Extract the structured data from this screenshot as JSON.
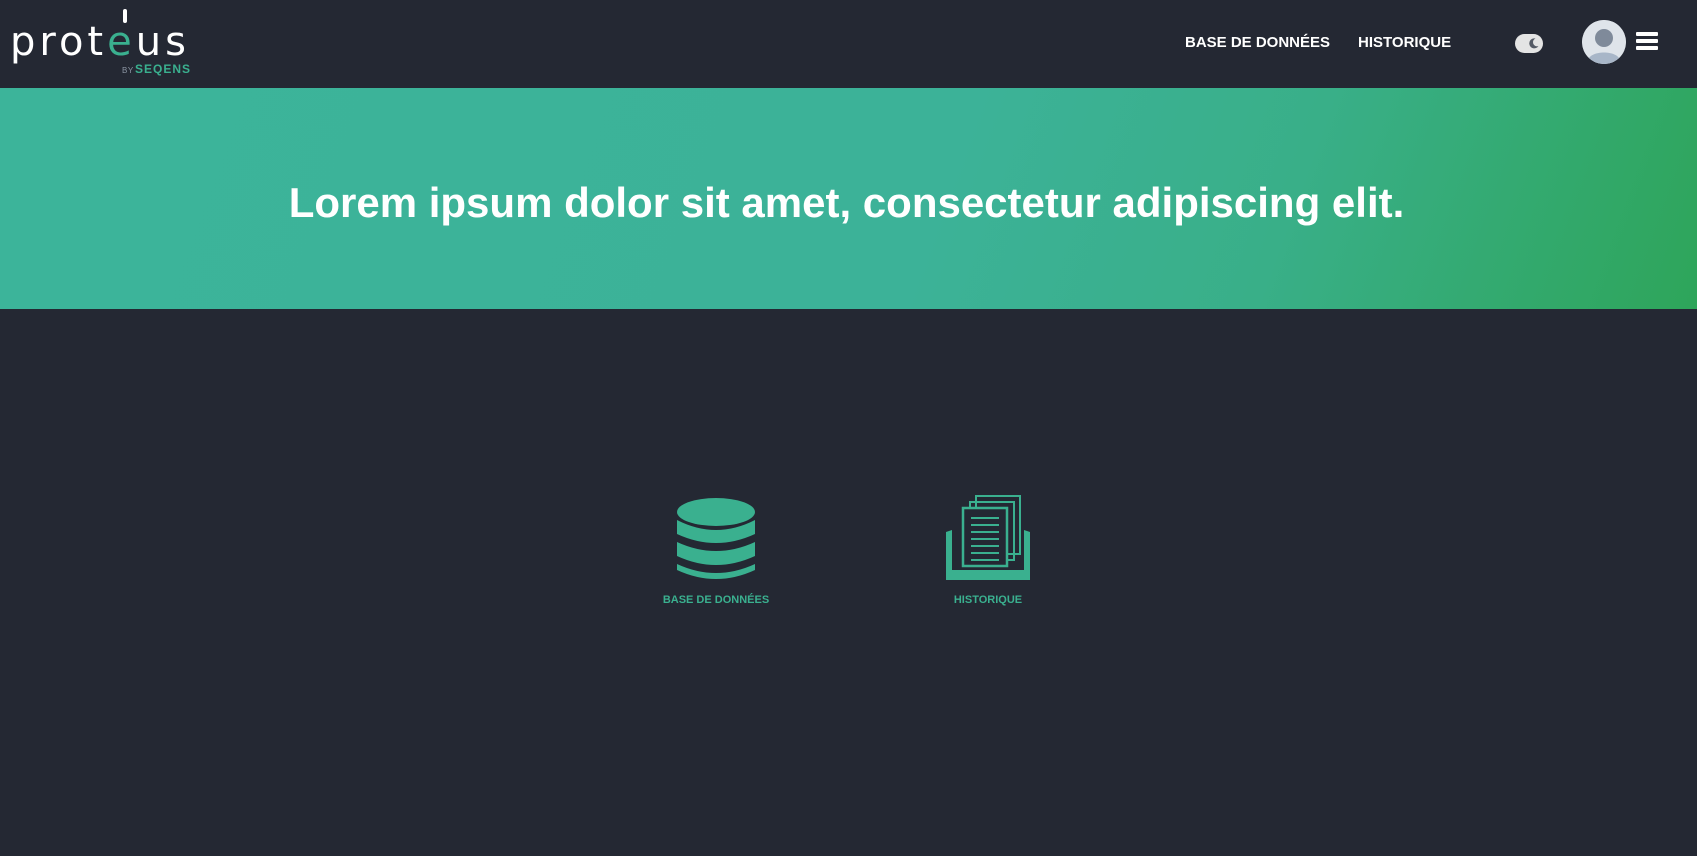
{
  "header": {
    "logo": {
      "word_before": "prot",
      "word_accent": "e",
      "word_after": "us",
      "by": "BY",
      "brand": "SEQENS"
    },
    "nav": {
      "database": "BASE DE DONNÉES",
      "history": "HISTORIQUE"
    },
    "icons": {
      "theme_toggle": "moon-icon",
      "avatar": "user-avatar-icon",
      "menu": "hamburger-menu-icon"
    }
  },
  "banner": {
    "title": "Lorem ipsum dolor sit amet, consectetur adipiscing elit."
  },
  "tiles": [
    {
      "label": "BASE DE DONNÉES",
      "icon": "database-icon"
    },
    {
      "label": "HISTORIQUE",
      "icon": "documents-tray-icon"
    }
  ],
  "colors": {
    "background": "#242833",
    "accent": "#3ab08f",
    "banner_start": "#3cb49a",
    "banner_end": "#2ea55a",
    "text": "#ffffff"
  }
}
